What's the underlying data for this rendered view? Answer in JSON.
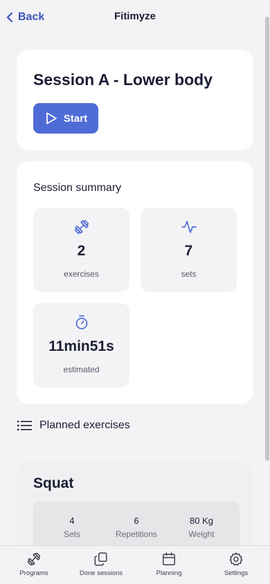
{
  "header": {
    "back_label": "Back",
    "title": "Fitimyze"
  },
  "session": {
    "title": "Session A - Lower body",
    "start_label": "Start"
  },
  "summary": {
    "title": "Session summary",
    "stats": [
      {
        "value": "2",
        "label": "exercises",
        "icon": "dumbbell-icon"
      },
      {
        "value": "7",
        "label": "sets",
        "icon": "activity-icon"
      },
      {
        "value": "11min51s",
        "label": "estimated",
        "icon": "stopwatch-icon"
      }
    ]
  },
  "planned": {
    "label": "Planned exercises"
  },
  "exercises": [
    {
      "name": "Squat",
      "metrics": [
        {
          "value": "4",
          "label": "Sets"
        },
        {
          "value": "6",
          "label": "Repetitions"
        },
        {
          "value": "80 Kg",
          "label": "Weight"
        }
      ]
    }
  ],
  "nav": {
    "items": [
      {
        "label": "Programs",
        "icon": "dumbbell-icon"
      },
      {
        "label": "Done sessions",
        "icon": "copy-icon"
      },
      {
        "label": "Planning",
        "icon": "calendar-icon"
      },
      {
        "label": "Settings",
        "icon": "gear-icon"
      }
    ]
  },
  "colors": {
    "accent": "#4f6bd6",
    "link": "#3a55b8",
    "background": "#f3f3f5",
    "card": "#ffffff",
    "text": "#1b1e33"
  }
}
